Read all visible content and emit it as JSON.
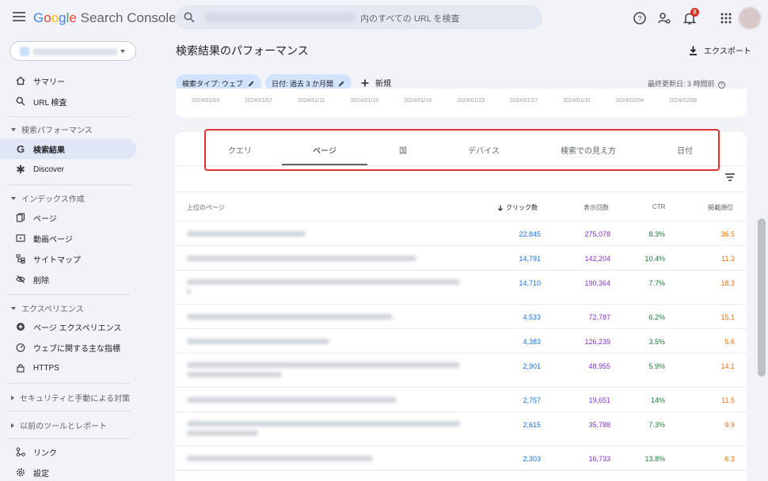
{
  "app": {
    "logo_google": [
      "G",
      "o",
      "o",
      "g",
      "l",
      "e"
    ],
    "logo_product": "Search Console"
  },
  "search": {
    "placeholder": "内のすべての URL を検査"
  },
  "top": {
    "notification_count": "8"
  },
  "sidebar": {
    "items": [
      {
        "label": "サマリー",
        "icon": "home-icon"
      },
      {
        "label": "URL 検査",
        "icon": "search-icon"
      }
    ],
    "sections": [
      {
        "title": "検索パフォーマンス",
        "expanded": true,
        "items": [
          {
            "label": "検索結果",
            "icon": "google-g-icon",
            "active": true
          },
          {
            "label": "Discover",
            "icon": "asterisk-icon"
          }
        ]
      },
      {
        "title": "インデックス作成",
        "expanded": true,
        "items": [
          {
            "label": "ページ",
            "icon": "pages-icon"
          },
          {
            "label": "動画ページ",
            "icon": "video-icon"
          },
          {
            "label": "サイトマップ",
            "icon": "sitemap-icon"
          },
          {
            "label": "削除",
            "icon": "removal-icon"
          }
        ]
      },
      {
        "title": "エクスペリエンス",
        "expanded": true,
        "items": [
          {
            "label": "ページ エクスペリエンス",
            "icon": "plus-circle-icon"
          },
          {
            "label": "ウェブに関する主な指標",
            "icon": "gauge-icon"
          },
          {
            "label": "HTTPS",
            "icon": "lock-icon"
          }
        ]
      },
      {
        "title": "セキュリティと手動による対策",
        "expanded": false
      },
      {
        "title": "以前のツールとレポート",
        "expanded": false
      }
    ],
    "bottom_items": [
      {
        "label": "リンク",
        "icon": "links-icon"
      },
      {
        "label": "設定",
        "icon": "gear-icon"
      }
    ]
  },
  "main": {
    "title": "検索結果のパフォーマンス",
    "export_label": "エクスポート",
    "filters": [
      {
        "label": "検索タイプ: ウェブ"
      },
      {
        "label": "日付: 過去 3 か月間"
      }
    ],
    "new_label": "新規",
    "last_updated": "最終更新日: 3 時間前"
  },
  "chart_data": {
    "type": "line",
    "x": [
      "2024/01/03",
      "2024/01/07",
      "2024/01/11",
      "2024/01/15",
      "2024/01/19",
      "2024/01/23",
      "2024/01/27",
      "2024/01/31",
      "2024/02/04",
      "2024/02/08"
    ]
  },
  "tabs": [
    "クエリ",
    "ページ",
    "国",
    "デバイス",
    "検索での見え方",
    "日付"
  ],
  "active_tab": 1,
  "table": {
    "columns": [
      "上位のページ",
      "クリック数",
      "表示回数",
      "CTR",
      "掲載順位"
    ],
    "sorted_column": 1,
    "rows": [
      {
        "clicks": "22,845",
        "impressions": "275,078",
        "ctr": "8.3%",
        "position": "36.5"
      },
      {
        "clicks": "14,791",
        "impressions": "142,204",
        "ctr": "10.4%",
        "position": "11.3"
      },
      {
        "clicks": "14,710",
        "impressions": "190,364",
        "ctr": "7.7%",
        "position": "18.3"
      },
      {
        "clicks": "4,533",
        "impressions": "72,787",
        "ctr": "6.2%",
        "position": "15.1"
      },
      {
        "clicks": "4,383",
        "impressions": "126,239",
        "ctr": "3.5%",
        "position": "5.6"
      },
      {
        "clicks": "2,901",
        "impressions": "48,955",
        "ctr": "5.9%",
        "position": "14.1"
      },
      {
        "clicks": "2,757",
        "impressions": "19,651",
        "ctr": "14%",
        "position": "11.5"
      },
      {
        "clicks": "2,615",
        "impressions": "35,788",
        "ctr": "7.3%",
        "position": "9.9"
      },
      {
        "clicks": "2,303",
        "impressions": "16,733",
        "ctr": "13.8%",
        "position": "6.3"
      }
    ]
  },
  "colors": {
    "clicks": "#1a73e8",
    "impressions": "#8430ce",
    "ctr": "#188038",
    "position": "#e8710a",
    "highlight": "#e0312f"
  }
}
